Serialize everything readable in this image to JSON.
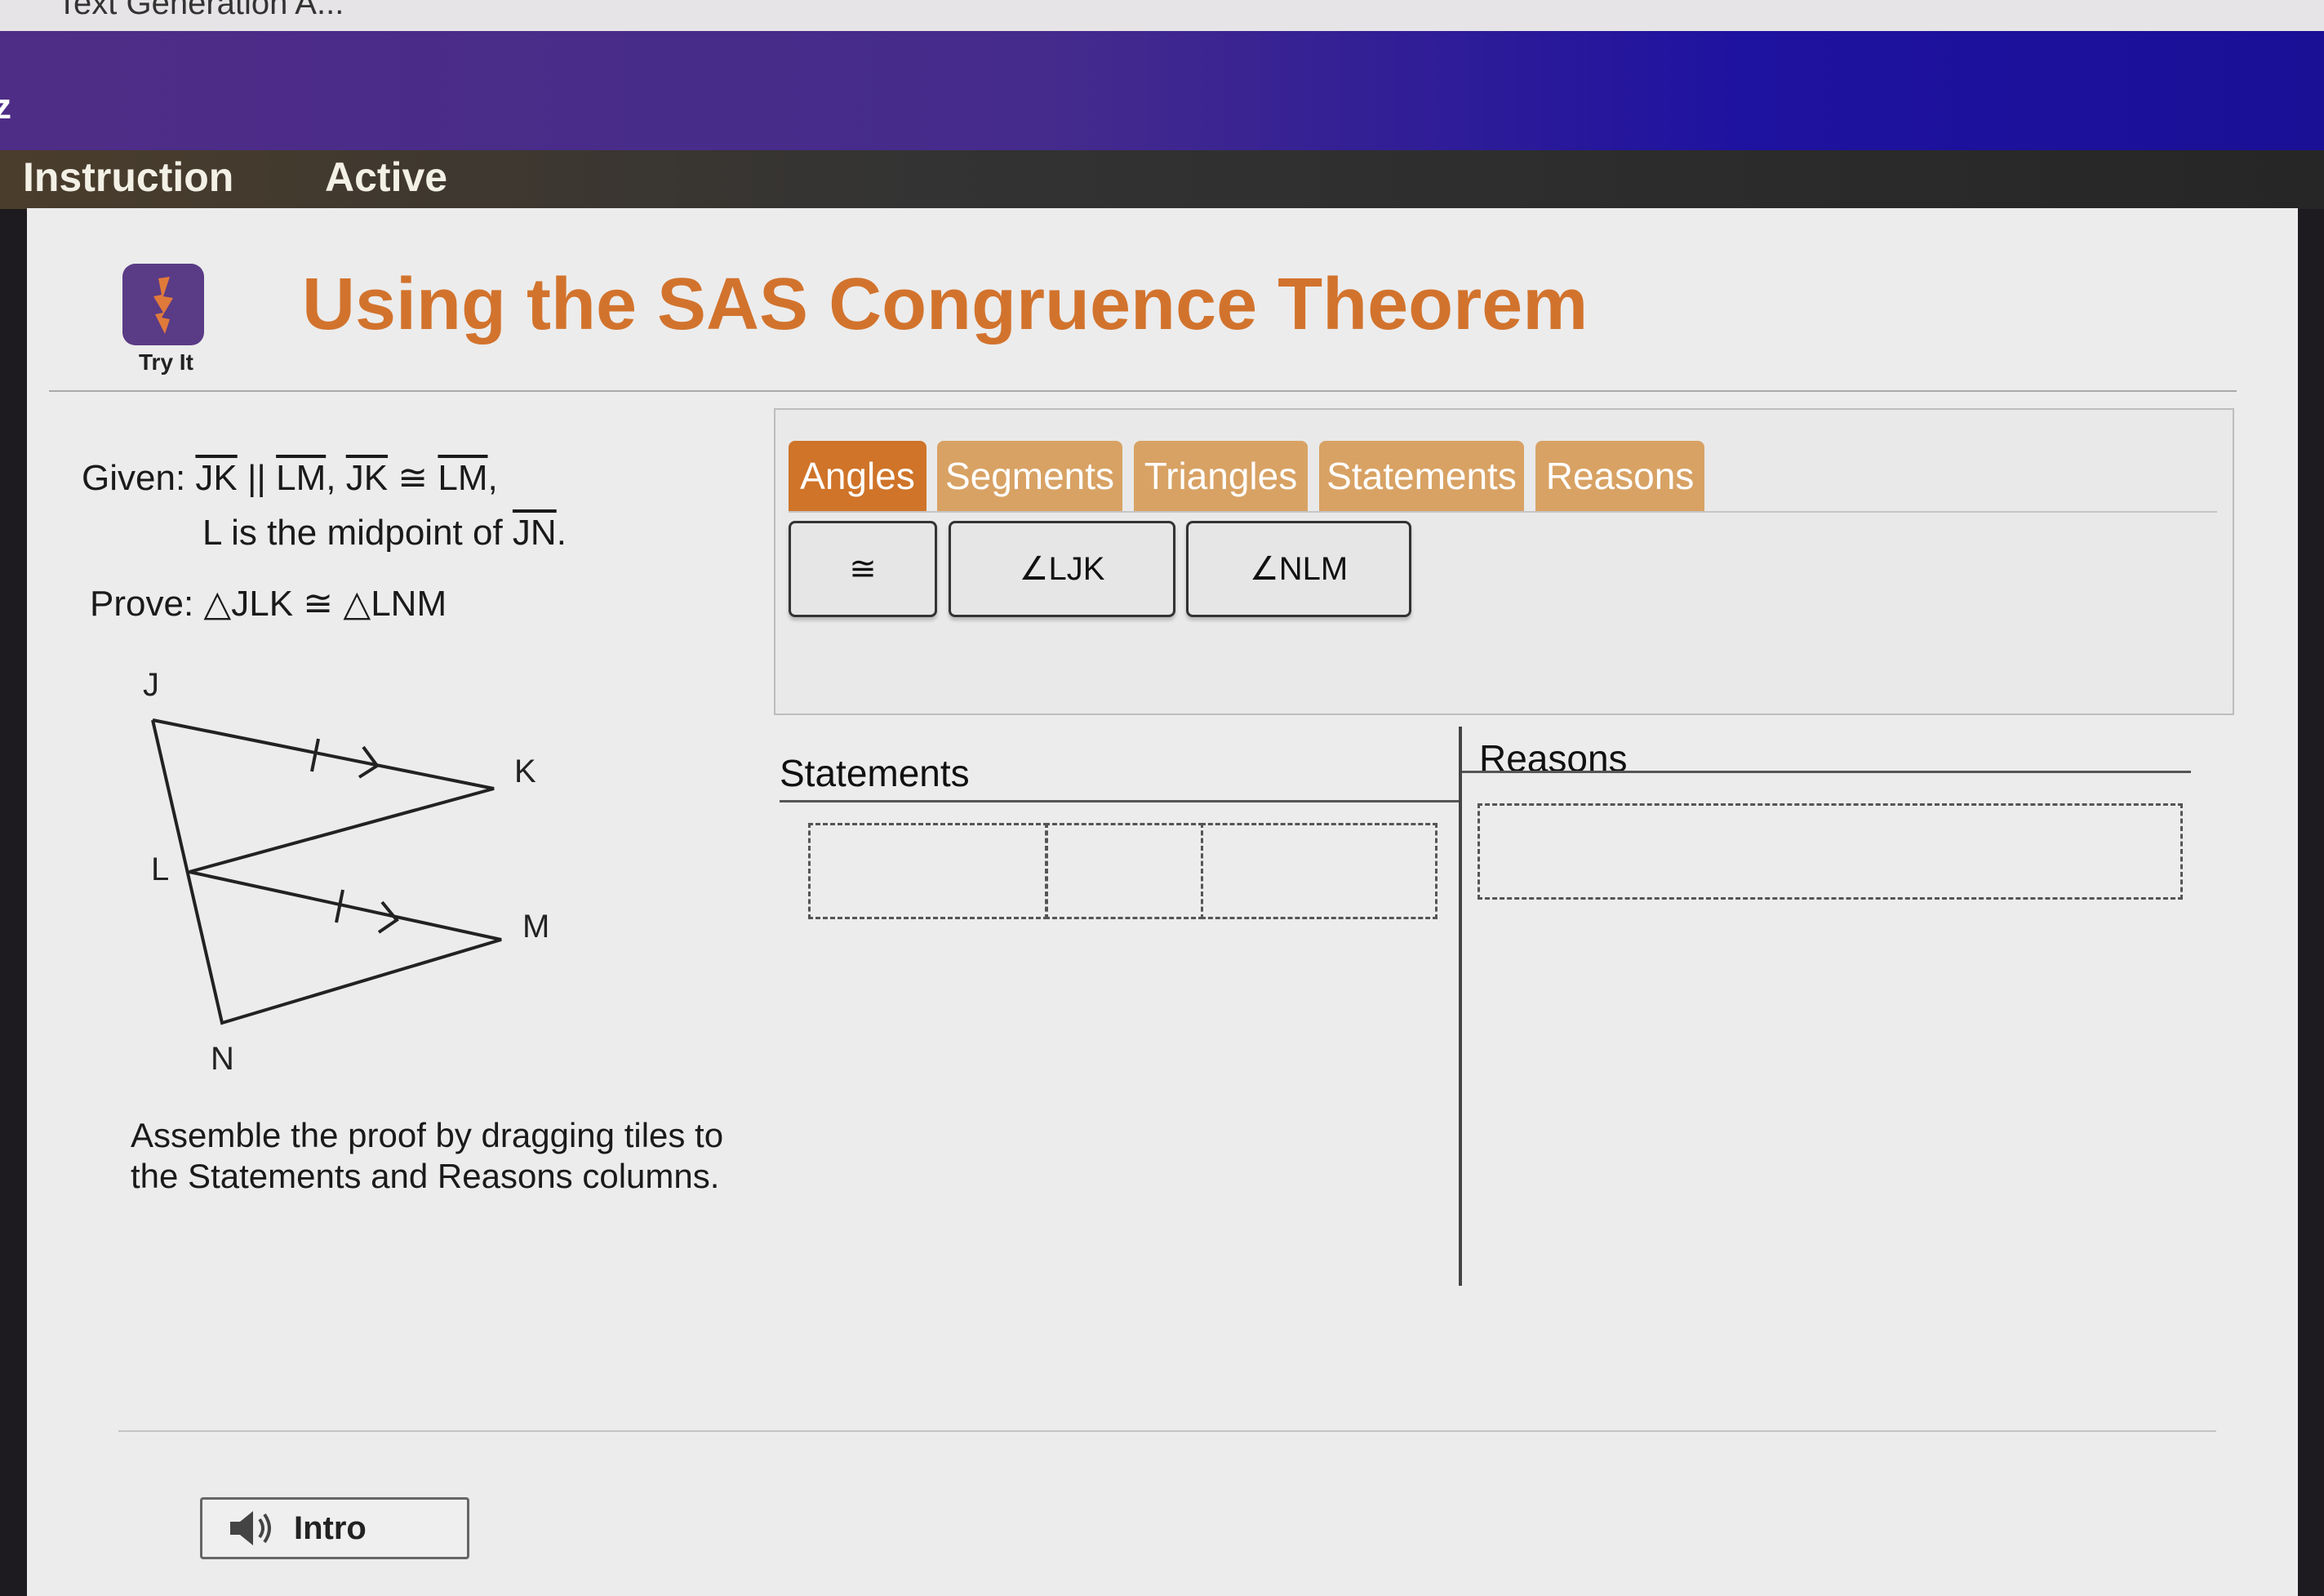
{
  "browser": {
    "tab_title": "Text Generation A..."
  },
  "app": {
    "brand_fragment": "z"
  },
  "nav": {
    "instruction": "Instruction",
    "active": "Active"
  },
  "header": {
    "badge_label": "Try It",
    "title": "Using the SAS Congruence Theorem"
  },
  "problem": {
    "given_label": "Given:",
    "given_seg1": "JK",
    "parallel": "||",
    "given_seg2": "LM",
    "comma1": ",",
    "given_seg3": "JK",
    "congruent": "≅",
    "given_seg4": "LM",
    "comma2": ",",
    "midpoint_text": "L is the midpoint of",
    "midpoint_seg": "JN",
    "period": ".",
    "prove": "Prove: △JLK ≅ △LNM",
    "instructions": "Assemble the proof by dragging tiles to the Statements and Reasons columns."
  },
  "diagram": {
    "labels": {
      "J": "J",
      "K": "K",
      "L": "L",
      "M": "M",
      "N": "N"
    }
  },
  "tiles": {
    "tabs": [
      {
        "label": "Angles",
        "active": true
      },
      {
        "label": "Segments",
        "active": false
      },
      {
        "label": "Triangles",
        "active": false
      },
      {
        "label": "Statements",
        "active": false
      },
      {
        "label": "Reasons",
        "active": false
      }
    ],
    "items": [
      "≅",
      "∠LJK",
      "∠NLM"
    ]
  },
  "proof": {
    "statements_header": "Statements",
    "reasons_header": "Reasons"
  },
  "footer": {
    "intro_label": "Intro"
  },
  "colors": {
    "accent": "#d2732d",
    "active_tab": "#cf7429",
    "tab": "#d8a264",
    "brand_purple": "#4e2d86"
  }
}
